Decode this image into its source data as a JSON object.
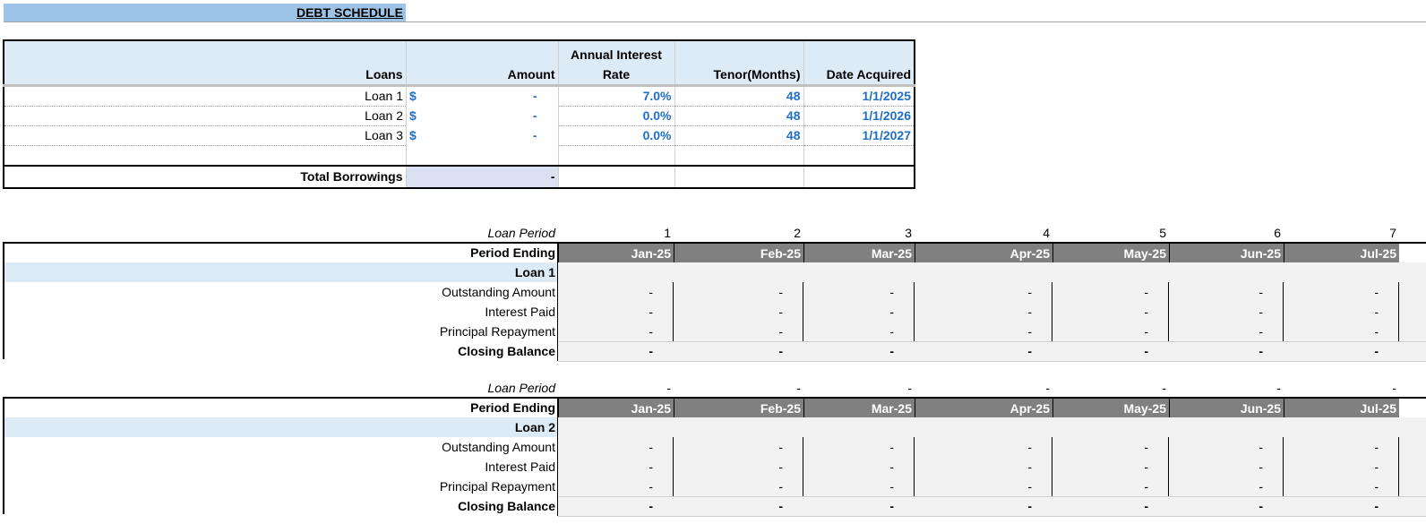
{
  "title": "DEBT SCHEDULE",
  "loans_table": {
    "headers": [
      "Loans",
      "Amount",
      "Annual Interest Rate",
      "Tenor(Months)",
      "Date Acquired"
    ],
    "rows": [
      {
        "name": "Loan 1",
        "currency": "$",
        "amount": "-",
        "rate": "7.0%",
        "tenor": "48",
        "date": "1/1/2025"
      },
      {
        "name": "Loan 2",
        "currency": "$",
        "amount": "-",
        "rate": "0.0%",
        "tenor": "48",
        "date": "1/1/2026"
      },
      {
        "name": "Loan 3",
        "currency": "$",
        "amount": "-",
        "rate": "0.0%",
        "tenor": "48",
        "date": "1/1/2027"
      }
    ],
    "total_label": "Total Borrowings",
    "total_value": "-"
  },
  "schedules": [
    {
      "loan_period_label": "Loan Period",
      "periods": [
        "1",
        "2",
        "3",
        "4",
        "5",
        "6",
        "7"
      ],
      "period_ending_label": "Period Ending",
      "months": [
        "Jan-25",
        "Feb-25",
        "Mar-25",
        "Apr-25",
        "May-25",
        "Jun-25",
        "Jul-25"
      ],
      "loan_label": "Loan 1",
      "rows": [
        {
          "label": "Outstanding Amount",
          "values": [
            "-",
            "-",
            "-",
            "-",
            "-",
            "-",
            "-"
          ]
        },
        {
          "label": "Interest Paid",
          "values": [
            "-",
            "-",
            "-",
            "-",
            "-",
            "-",
            "-"
          ]
        },
        {
          "label": "Principal Repayment",
          "values": [
            "-",
            "-",
            "-",
            "-",
            "-",
            "-",
            "-"
          ]
        }
      ],
      "closing_label": "Closing Balance",
      "closing_values": [
        "-",
        "-",
        "-",
        "-",
        "-",
        "-",
        "-"
      ]
    },
    {
      "loan_period_label": "Loan Period",
      "periods": [
        "-",
        "-",
        "-",
        "-",
        "-",
        "-",
        "-"
      ],
      "period_ending_label": "Period Ending",
      "months": [
        "Jan-25",
        "Feb-25",
        "Mar-25",
        "Apr-25",
        "May-25",
        "Jun-25",
        "Jul-25"
      ],
      "loan_label": "Loan 2",
      "rows": [
        {
          "label": "Outstanding Amount",
          "values": [
            "-",
            "-",
            "-",
            "-",
            "-",
            "-",
            "-"
          ]
        },
        {
          "label": "Interest Paid",
          "values": [
            "-",
            "-",
            "-",
            "-",
            "-",
            "-",
            "-"
          ]
        },
        {
          "label": "Principal Repayment",
          "values": [
            "-",
            "-",
            "-",
            "-",
            "-",
            "-",
            "-"
          ]
        }
      ],
      "closing_label": "Closing Balance",
      "closing_values": [
        "-",
        "-",
        "-",
        "-",
        "-",
        "-",
        "-"
      ]
    }
  ]
}
